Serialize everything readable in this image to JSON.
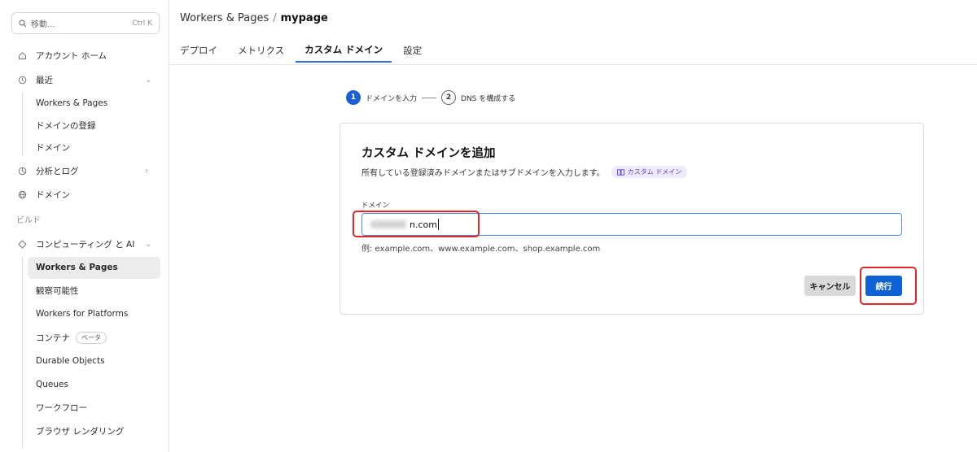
{
  "sidebar": {
    "search": {
      "placeholder": "移動...",
      "shortcut": "Ctrl K"
    },
    "items": [
      {
        "label": "アカウント ホーム",
        "icon": "home-icon"
      },
      {
        "label": "最近",
        "icon": "clock-icon",
        "expanded": true,
        "children": [
          "Workers & Pages",
          "ドメインの登録",
          "ドメイン"
        ]
      },
      {
        "label": "分析とログ",
        "icon": "chart-icon",
        "expanded": false
      },
      {
        "label": "ドメイン",
        "icon": "globe-icon"
      }
    ],
    "section_label": "ビルド",
    "compute": {
      "label": "コンピューティング と AI",
      "icon": "compute-icon",
      "children": [
        {
          "label": "Workers & Pages",
          "active": true
        },
        {
          "label": "観察可能性"
        },
        {
          "label": "Workers for Platforms"
        },
        {
          "label": "コンテナ",
          "badge": "ベータ"
        },
        {
          "label": "Durable Objects"
        },
        {
          "label": "Queues"
        },
        {
          "label": "ワークフロー"
        },
        {
          "label": "ブラウザ レンダリング"
        }
      ]
    }
  },
  "header": {
    "breadcrumb_parent": "Workers & Pages",
    "breadcrumb_sep": "/",
    "breadcrumb_current": "mypage",
    "tabs": [
      {
        "label": "デプロイ"
      },
      {
        "label": "メトリクス"
      },
      {
        "label": "カスタム ドメイン",
        "active": true
      },
      {
        "label": "設定"
      }
    ]
  },
  "stepper": {
    "steps": [
      {
        "number": "1",
        "label": "ドメインを入力",
        "active": true
      },
      {
        "number": "2",
        "label": "DNS を構成する",
        "active": false
      }
    ]
  },
  "card": {
    "title": "カスタム ドメインを追加",
    "description": "所有している登録済みドメインまたはサブドメインを入力します。",
    "doc_chip": "カスタム ドメイン",
    "field_label": "ドメイン",
    "input_value": "n.com",
    "example": "例: example.com、www.example.com、shop.example.com",
    "cancel_label": "キャンセル",
    "continue_label": "続行"
  },
  "colors": {
    "accent": "#0f62d6",
    "tab_underline": "#2f6fd8",
    "highlight": "#e2262b",
    "chip_bg": "#efeaff"
  }
}
